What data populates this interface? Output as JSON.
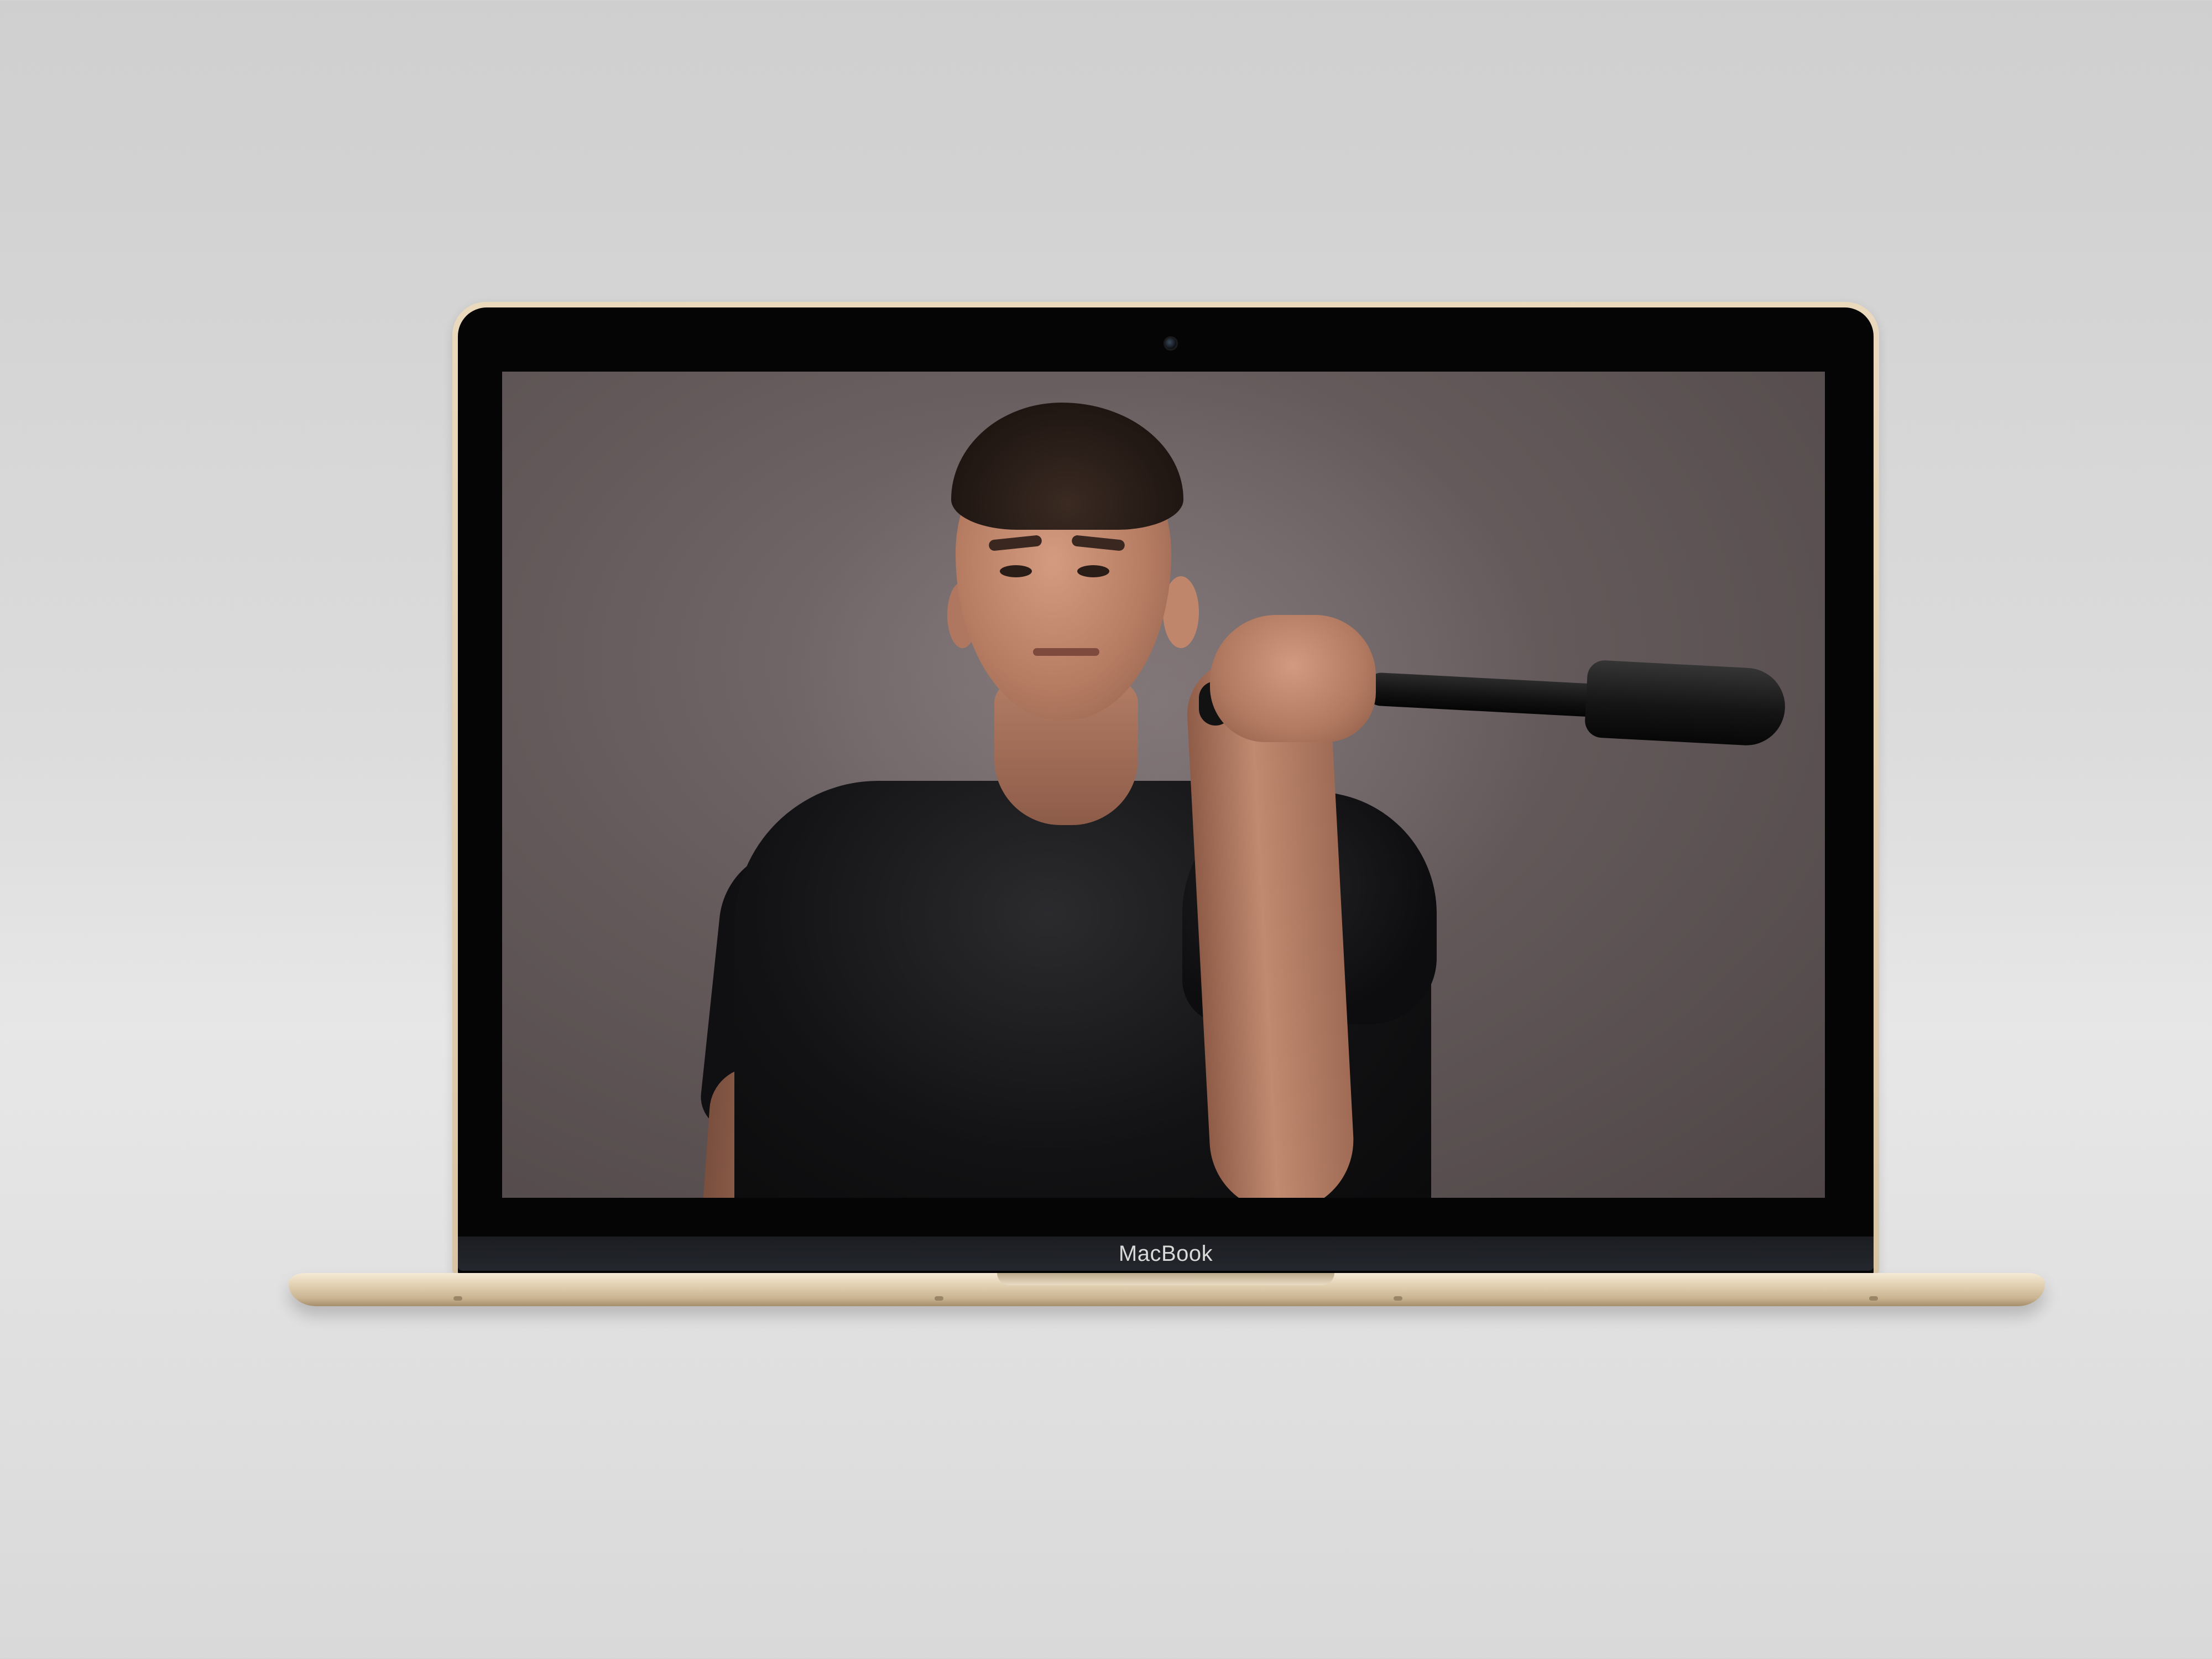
{
  "device": {
    "brand_label": "MacBook",
    "finish_color": "#d9c5a4",
    "bezel_color": "#050505",
    "background_color": "#dcdcdc"
  },
  "screen": {
    "content": "photo",
    "background_color": "#645a5b"
  }
}
